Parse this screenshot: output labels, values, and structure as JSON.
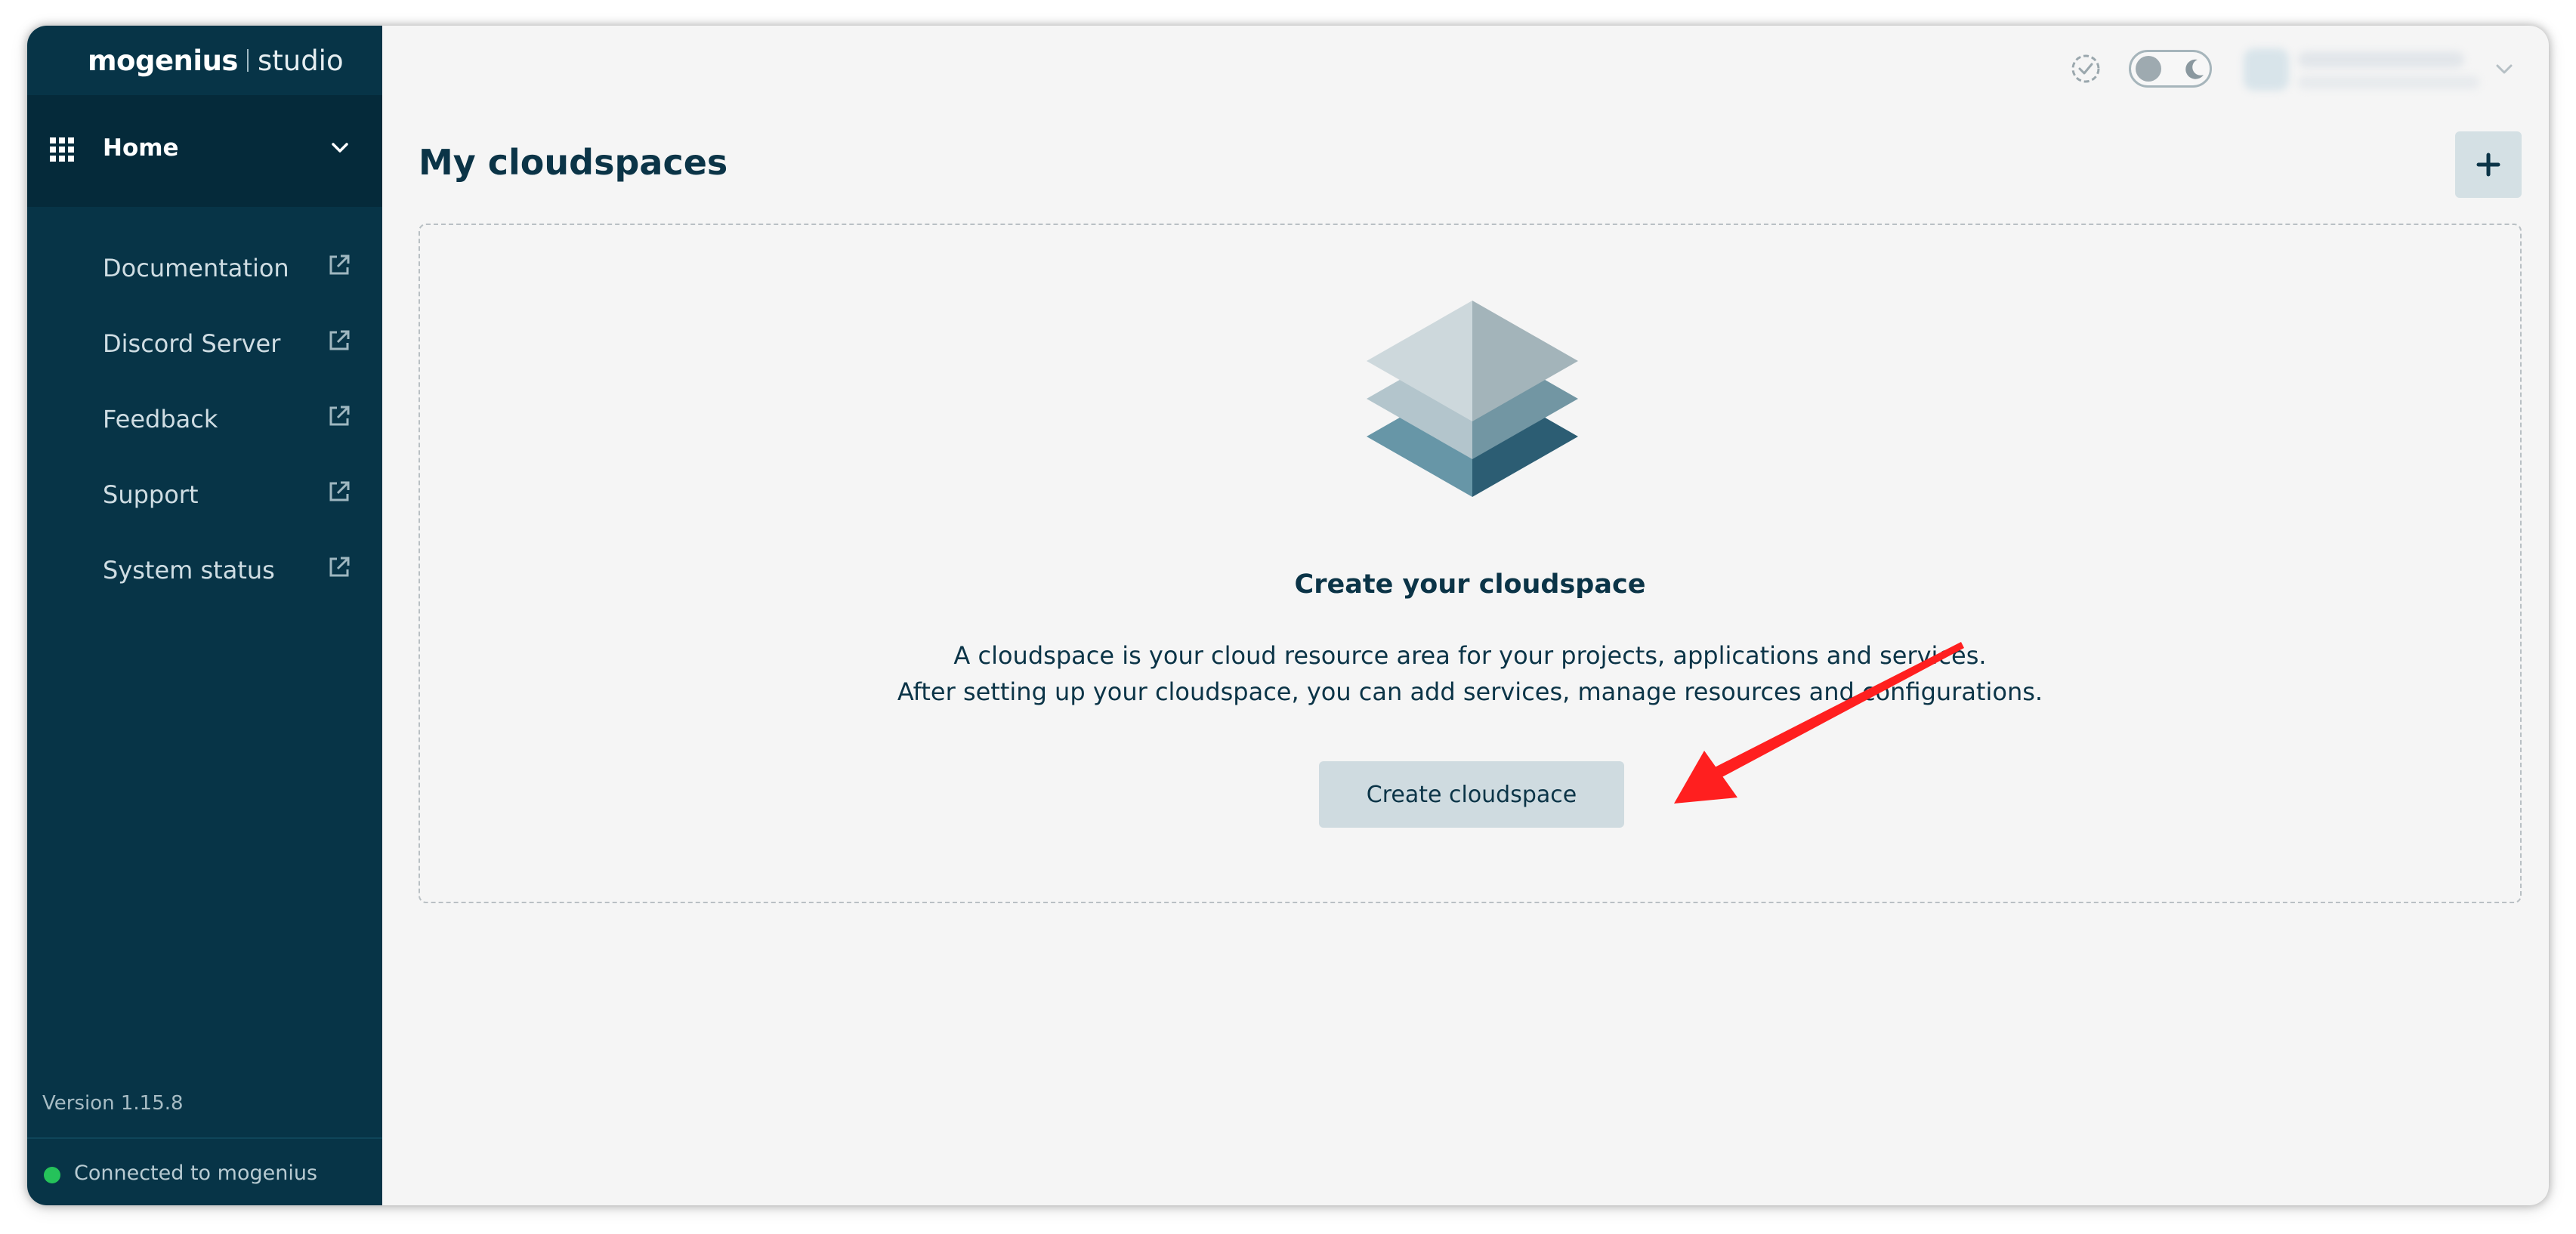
{
  "brand": {
    "name": "mogenius",
    "product": "studio"
  },
  "sidebar": {
    "home_label": "Home",
    "items": [
      {
        "label": "Documentation"
      },
      {
        "label": "Discord Server"
      },
      {
        "label": "Feedback"
      },
      {
        "label": "Support"
      },
      {
        "label": "System status"
      }
    ],
    "version": "Version 1.15.8",
    "connection_status": "Connected to mogenius"
  },
  "main": {
    "title": "My cloudspaces",
    "add_button_label": "+",
    "empty_state": {
      "title": "Create your cloudspace",
      "description_line1": "A cloudspace is your cloud resource area for your projects, applications and services.",
      "description_line2": "After setting up your cloudspace, you can add services, manage resources and configurations.",
      "button_label": "Create cloudspace"
    }
  },
  "icons": {
    "home": "grid-icon",
    "external_link": "external-link-icon",
    "status_check": "check-circle-icon",
    "theme_toggle": "moon-icon",
    "user_menu": "chevron-down-icon",
    "empty_state": "layers-icon",
    "annotation": "red-arrow"
  },
  "colors": {
    "sidebar_bg": "#073447",
    "sidebar_active_bg": "#052a3a",
    "main_bg": "#f5f5f5",
    "text_dark": "#0b3447",
    "button_bg": "#cfdbe0",
    "status_green": "#25c25a",
    "annotation_red": "#ff1f1f"
  }
}
